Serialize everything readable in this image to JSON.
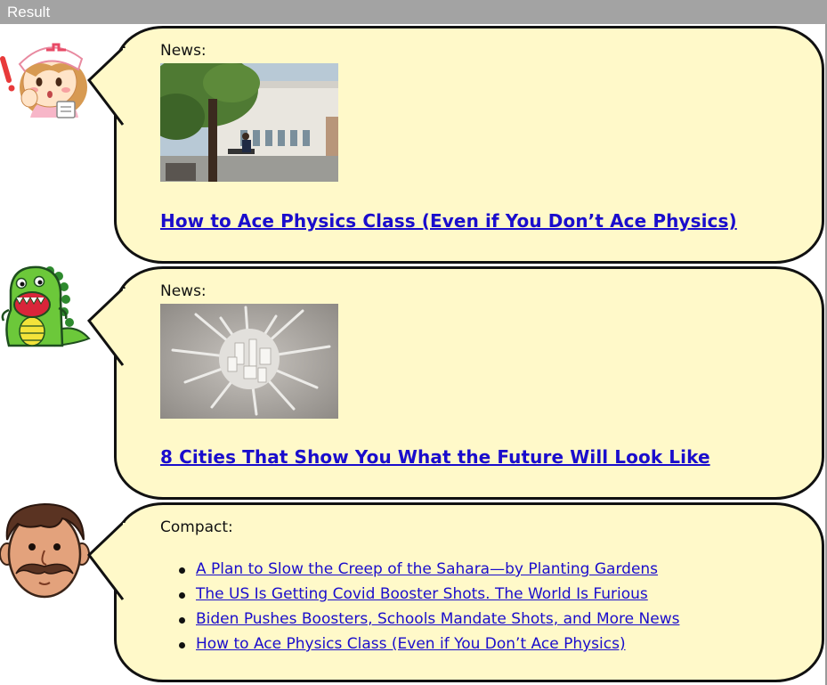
{
  "window": {
    "title": "Result"
  },
  "messages": [
    {
      "avatar": "nurse-avatar-icon",
      "kind_label": "News:",
      "thumbnail": "campus-building-photo",
      "headline": "How to Ace Physics Class (Even if You Don’t Ace Physics)"
    },
    {
      "avatar": "dinosaur-avatar-icon",
      "kind_label": "News:",
      "thumbnail": "city-model-photo",
      "headline": "8 Cities That Show You What the Future Will Look Like"
    },
    {
      "avatar": "mustache-man-avatar-icon",
      "kind_label": "Compact:",
      "links": [
        "A Plan to Slow the Creep of the Sahara—by Planting Gardens",
        "The US Is Getting Covid Booster Shots. The World Is Furious",
        "Biden Pushes Boosters, Schools Mandate Shots, and More News",
        "How to Ace Physics Class (Even if You Don’t Ace Physics)"
      ]
    }
  ],
  "colors": {
    "bubble_fill": "#fff9c9",
    "link": "#1a0dcc",
    "titlebar": "#a3a3a3"
  }
}
